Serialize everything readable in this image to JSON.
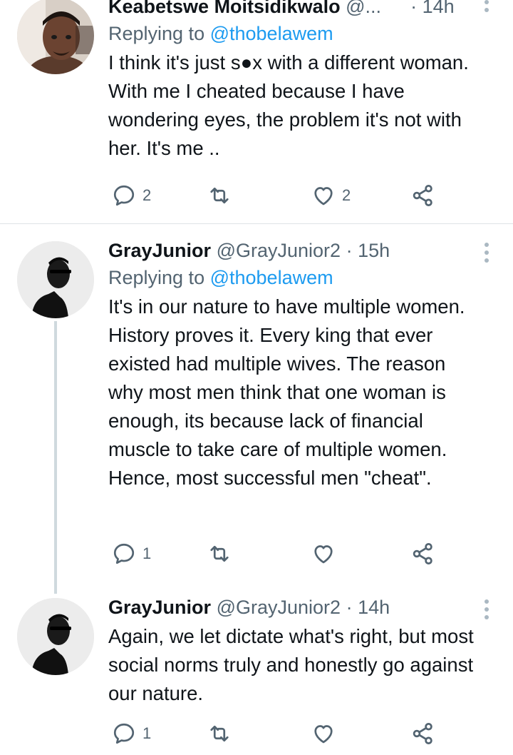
{
  "tweets": [
    {
      "name": "Keabetswe Moitsidikwalo",
      "handle": "@...",
      "dot": "·",
      "time": "14h",
      "reply_prefix": "Replying to ",
      "reply_to": "@thobelawem",
      "text": "I think it's just s●x with a different woman. With me I cheated because I have wondering eyes, the problem it's not with her. It's me ..",
      "reply_count": "2",
      "retweet_count": "",
      "like_count": "2"
    },
    {
      "name": "GrayJunior",
      "handle": "@GrayJunior2",
      "dot": "·",
      "time": "15h",
      "reply_prefix": "Replying to ",
      "reply_to": "@thobelawem",
      "text": "It's in our nature to have multiple women. History proves it. Every king that ever existed had multiple wives. The reason why most men think that one woman is enough, its because lack of financial muscle to take care of multiple women. Hence, most successful men \"cheat\".",
      "reply_count": "1",
      "retweet_count": "",
      "like_count": ""
    },
    {
      "name": "GrayJunior",
      "handle": "@GrayJunior2",
      "dot": "·",
      "time": "14h",
      "text": "Again, we let dictate what's right, but most social norms truly and honestly go against our nature.",
      "reply_count": "1",
      "retweet_count": "",
      "like_count": ""
    }
  ],
  "icons": {
    "reply": "reply-icon",
    "retweet": "retweet-icon",
    "like": "like-icon",
    "share": "share-icon",
    "more": "more-options-icon"
  },
  "colors": {
    "link": "#1d9bf0",
    "secondary_text": "#536471",
    "primary_text": "#0f1419",
    "thread_line": "#cfd9de"
  }
}
